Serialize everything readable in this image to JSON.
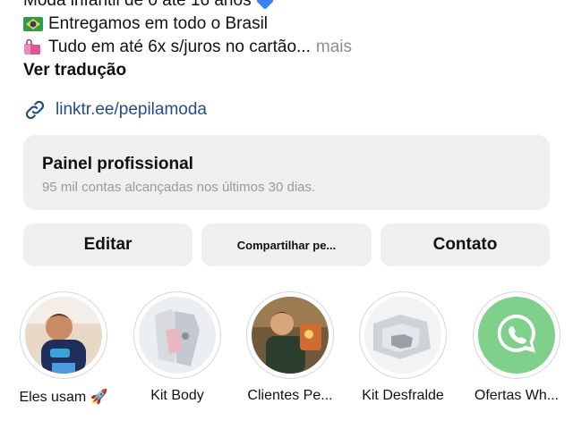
{
  "bio": {
    "line1": "Moda infantil de 0 até 16 anos",
    "line2": "Entregamos em todo o Brasil",
    "line3": "Tudo em até 6x s/juros no cartão...",
    "more": "mais",
    "translate": "Ver tradução"
  },
  "link": {
    "text": "linktr.ee/pepilamoda"
  },
  "panel": {
    "title": "Painel profissional",
    "subtitle": "95 mil contas alcançadas nos últimos 30 dias."
  },
  "buttons": {
    "edit": "Editar",
    "share": "Compartilhar pe...",
    "contact": "Contato"
  },
  "highlights": [
    {
      "label": "Eles usam 🚀",
      "icon": "kid-photo"
    },
    {
      "label": "Kit Body",
      "icon": "clothes-photo"
    },
    {
      "label": "Clientes Pe...",
      "icon": "kid-photo"
    },
    {
      "label": "Kit Desfralde",
      "icon": "clothes-photo"
    },
    {
      "label": "Ofertas Wh...",
      "icon": "whatsapp-icon"
    }
  ],
  "colors": {
    "link": "#1f4e8a",
    "panel_bg": "#efefef",
    "whatsapp_green": "#25d366"
  }
}
